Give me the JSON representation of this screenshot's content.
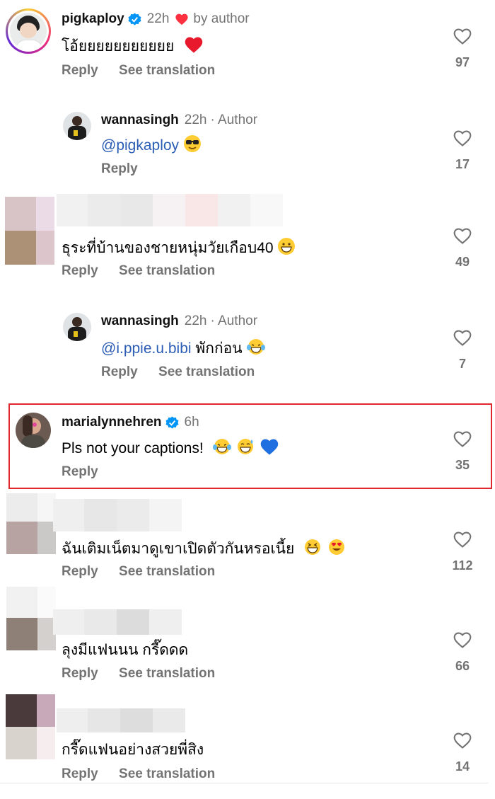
{
  "comments": [
    {
      "username": "pigkaploy",
      "time": "22h",
      "liked_by_author": "by author",
      "text": "โอ้ยยยยยยยยยยย",
      "reply": "Reply",
      "translate": "See translation",
      "likes": "97"
    },
    {
      "username": "wannasingh",
      "time": "22h",
      "author_tag": "· Author",
      "mention": "@pigkaploy",
      "text": "",
      "reply": "Reply",
      "likes": "17"
    },
    {
      "username": "",
      "text": "ธุระที่บ้านของชายหนุ่มวัยเกือบ40",
      "reply": "Reply",
      "translate": "See translation",
      "likes": "49"
    },
    {
      "username": "wannasingh",
      "time": "22h",
      "author_tag": "· Author",
      "mention": "@i.ppie.u.bibi",
      "text": " พักก่อน",
      "reply": "Reply",
      "translate": "See translation",
      "likes": "7"
    },
    {
      "username": "marialynnehren",
      "time": "6h",
      "text": "Pls not your captions!",
      "reply": "Reply",
      "likes": "35"
    },
    {
      "username": "",
      "text": "ฉันเติมเน็ตมาดูเขาเปิดตัวกันหรอเนี้ย",
      "reply": "Reply",
      "translate": "See translation",
      "likes": "112"
    },
    {
      "username": "",
      "text": "ลุงมีแฟนนน กรี๊ดดด",
      "reply": "Reply",
      "translate": "See translation",
      "likes": "66"
    },
    {
      "username": "",
      "text": "กรี๊ดแฟนอย่างสวยพี่สิง",
      "reply": "Reply",
      "translate": "See translation",
      "likes": "14"
    }
  ],
  "colors": {
    "mention": "#2b5db5",
    "highlight": "#e0262f",
    "verified": "#0095f6",
    "heart": "#ff3040"
  }
}
